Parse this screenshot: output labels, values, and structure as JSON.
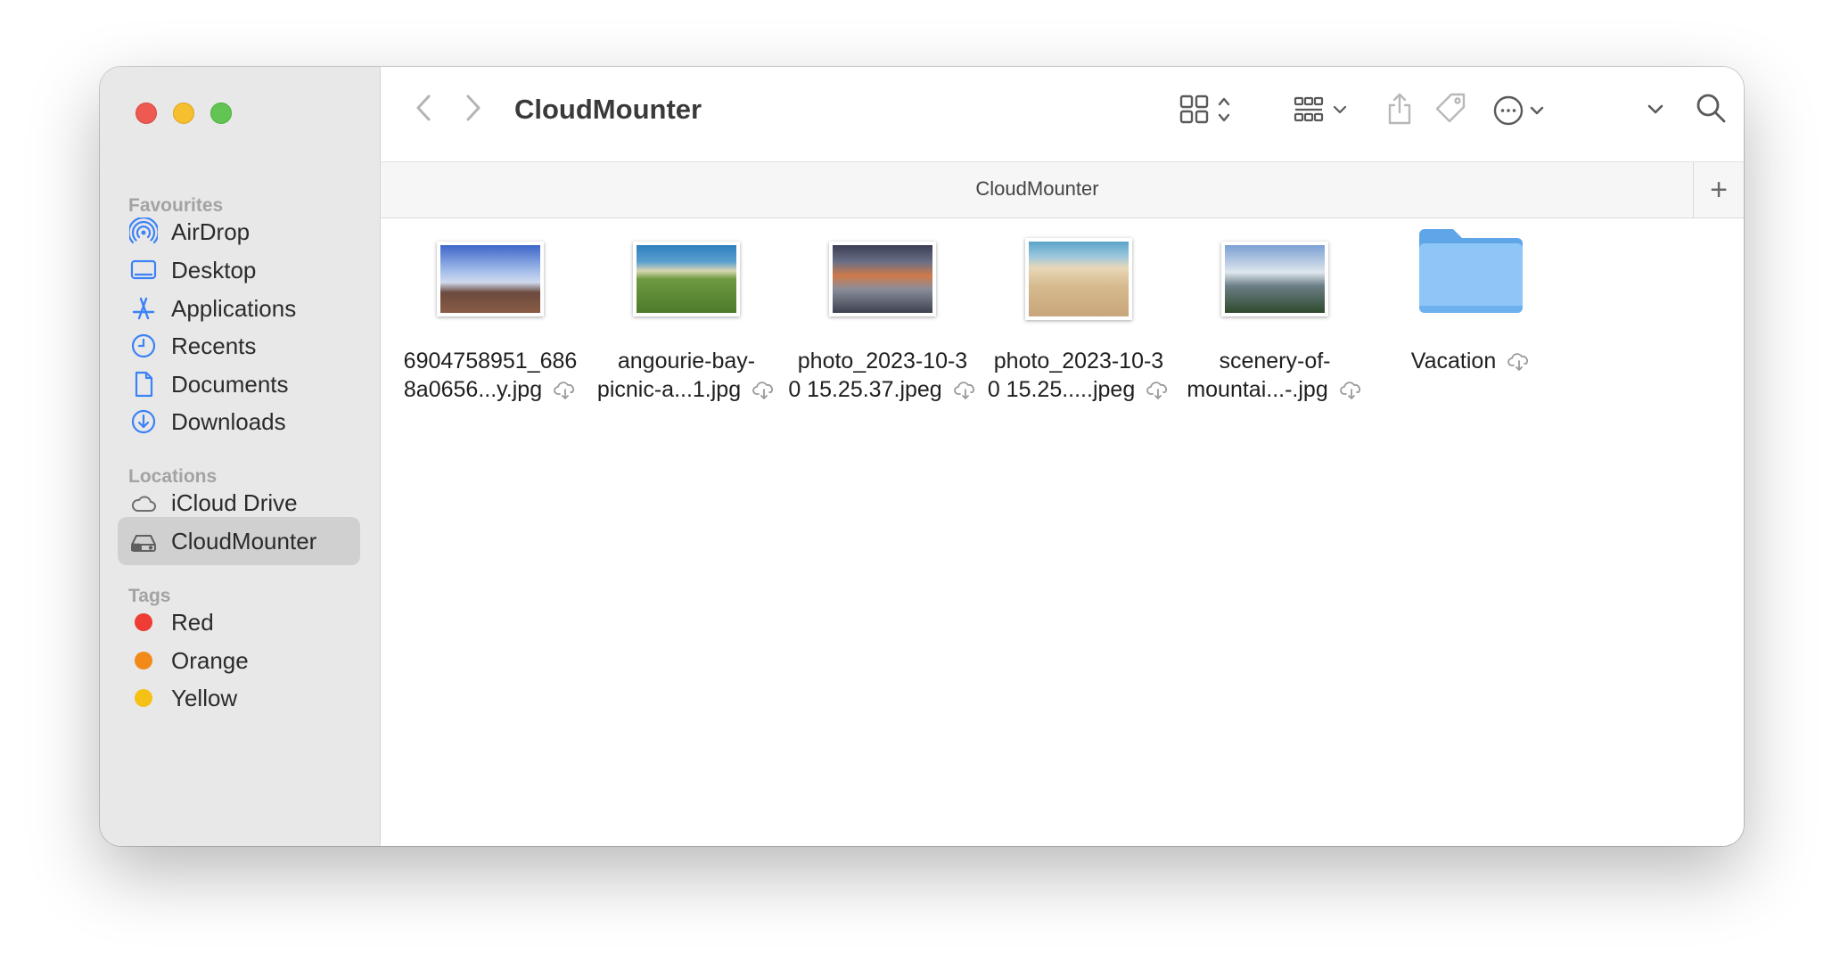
{
  "window": {
    "title": "CloudMounter"
  },
  "sidebar": {
    "favourites_title": "Favourites",
    "favourites": [
      {
        "label": "AirDrop",
        "icon": "airdrop-icon"
      },
      {
        "label": "Desktop",
        "icon": "desktop-icon"
      },
      {
        "label": "Applications",
        "icon": "applications-icon"
      },
      {
        "label": "Recents",
        "icon": "clock-icon"
      },
      {
        "label": "Documents",
        "icon": "document-icon"
      },
      {
        "label": "Downloads",
        "icon": "download-icon"
      }
    ],
    "locations_title": "Locations",
    "locations": [
      {
        "label": "iCloud Drive",
        "icon": "cloud-icon"
      },
      {
        "label": "CloudMounter",
        "icon": "drive-icon",
        "selected": true
      }
    ],
    "tags_title": "Tags",
    "tags": [
      {
        "label": "Red",
        "color": "#ee3d34"
      },
      {
        "label": "Orange",
        "color": "#f28a1a"
      },
      {
        "label": "Yellow",
        "color": "#f5c114"
      }
    ]
  },
  "pathbar": {
    "label": "CloudMounter",
    "add": "+"
  },
  "files": [
    {
      "name_line1": "6904758951_686",
      "name_line2": "8a0656...y.jpg",
      "icon": "image-thumbnail",
      "colors": [
        "#3d66c9",
        "#a8c1ea",
        "#6b4a3e"
      ]
    },
    {
      "name_line1": "angourie-bay-",
      "name_line2": "picnic-a...1.jpg",
      "icon": "image-thumbnail",
      "colors": [
        "#2f7fbf",
        "#d9d6b0",
        "#4d7a2a"
      ]
    },
    {
      "name_line1": "photo_2023-10-3",
      "name_line2": "0 15.25.37.jpeg",
      "icon": "image-thumbnail",
      "colors": [
        "#cf7a4a",
        "#6b6f86",
        "#3b3f56"
      ]
    },
    {
      "name_line1": "photo_2023-10-3",
      "name_line2": "0 15.25.....jpeg",
      "icon": "image-thumbnail",
      "colors": [
        "#5aa3c9",
        "#e8d7b7",
        "#c8a57b"
      ]
    },
    {
      "name_line1": "scenery-of-",
      "name_line2": "mountai...-.jpg",
      "icon": "image-thumbnail",
      "colors": [
        "#7aa1d4",
        "#dfe7ef",
        "#2f4a2e"
      ]
    },
    {
      "name_line1": "Vacation",
      "name_line2": "",
      "icon": "folder-icon"
    }
  ]
}
